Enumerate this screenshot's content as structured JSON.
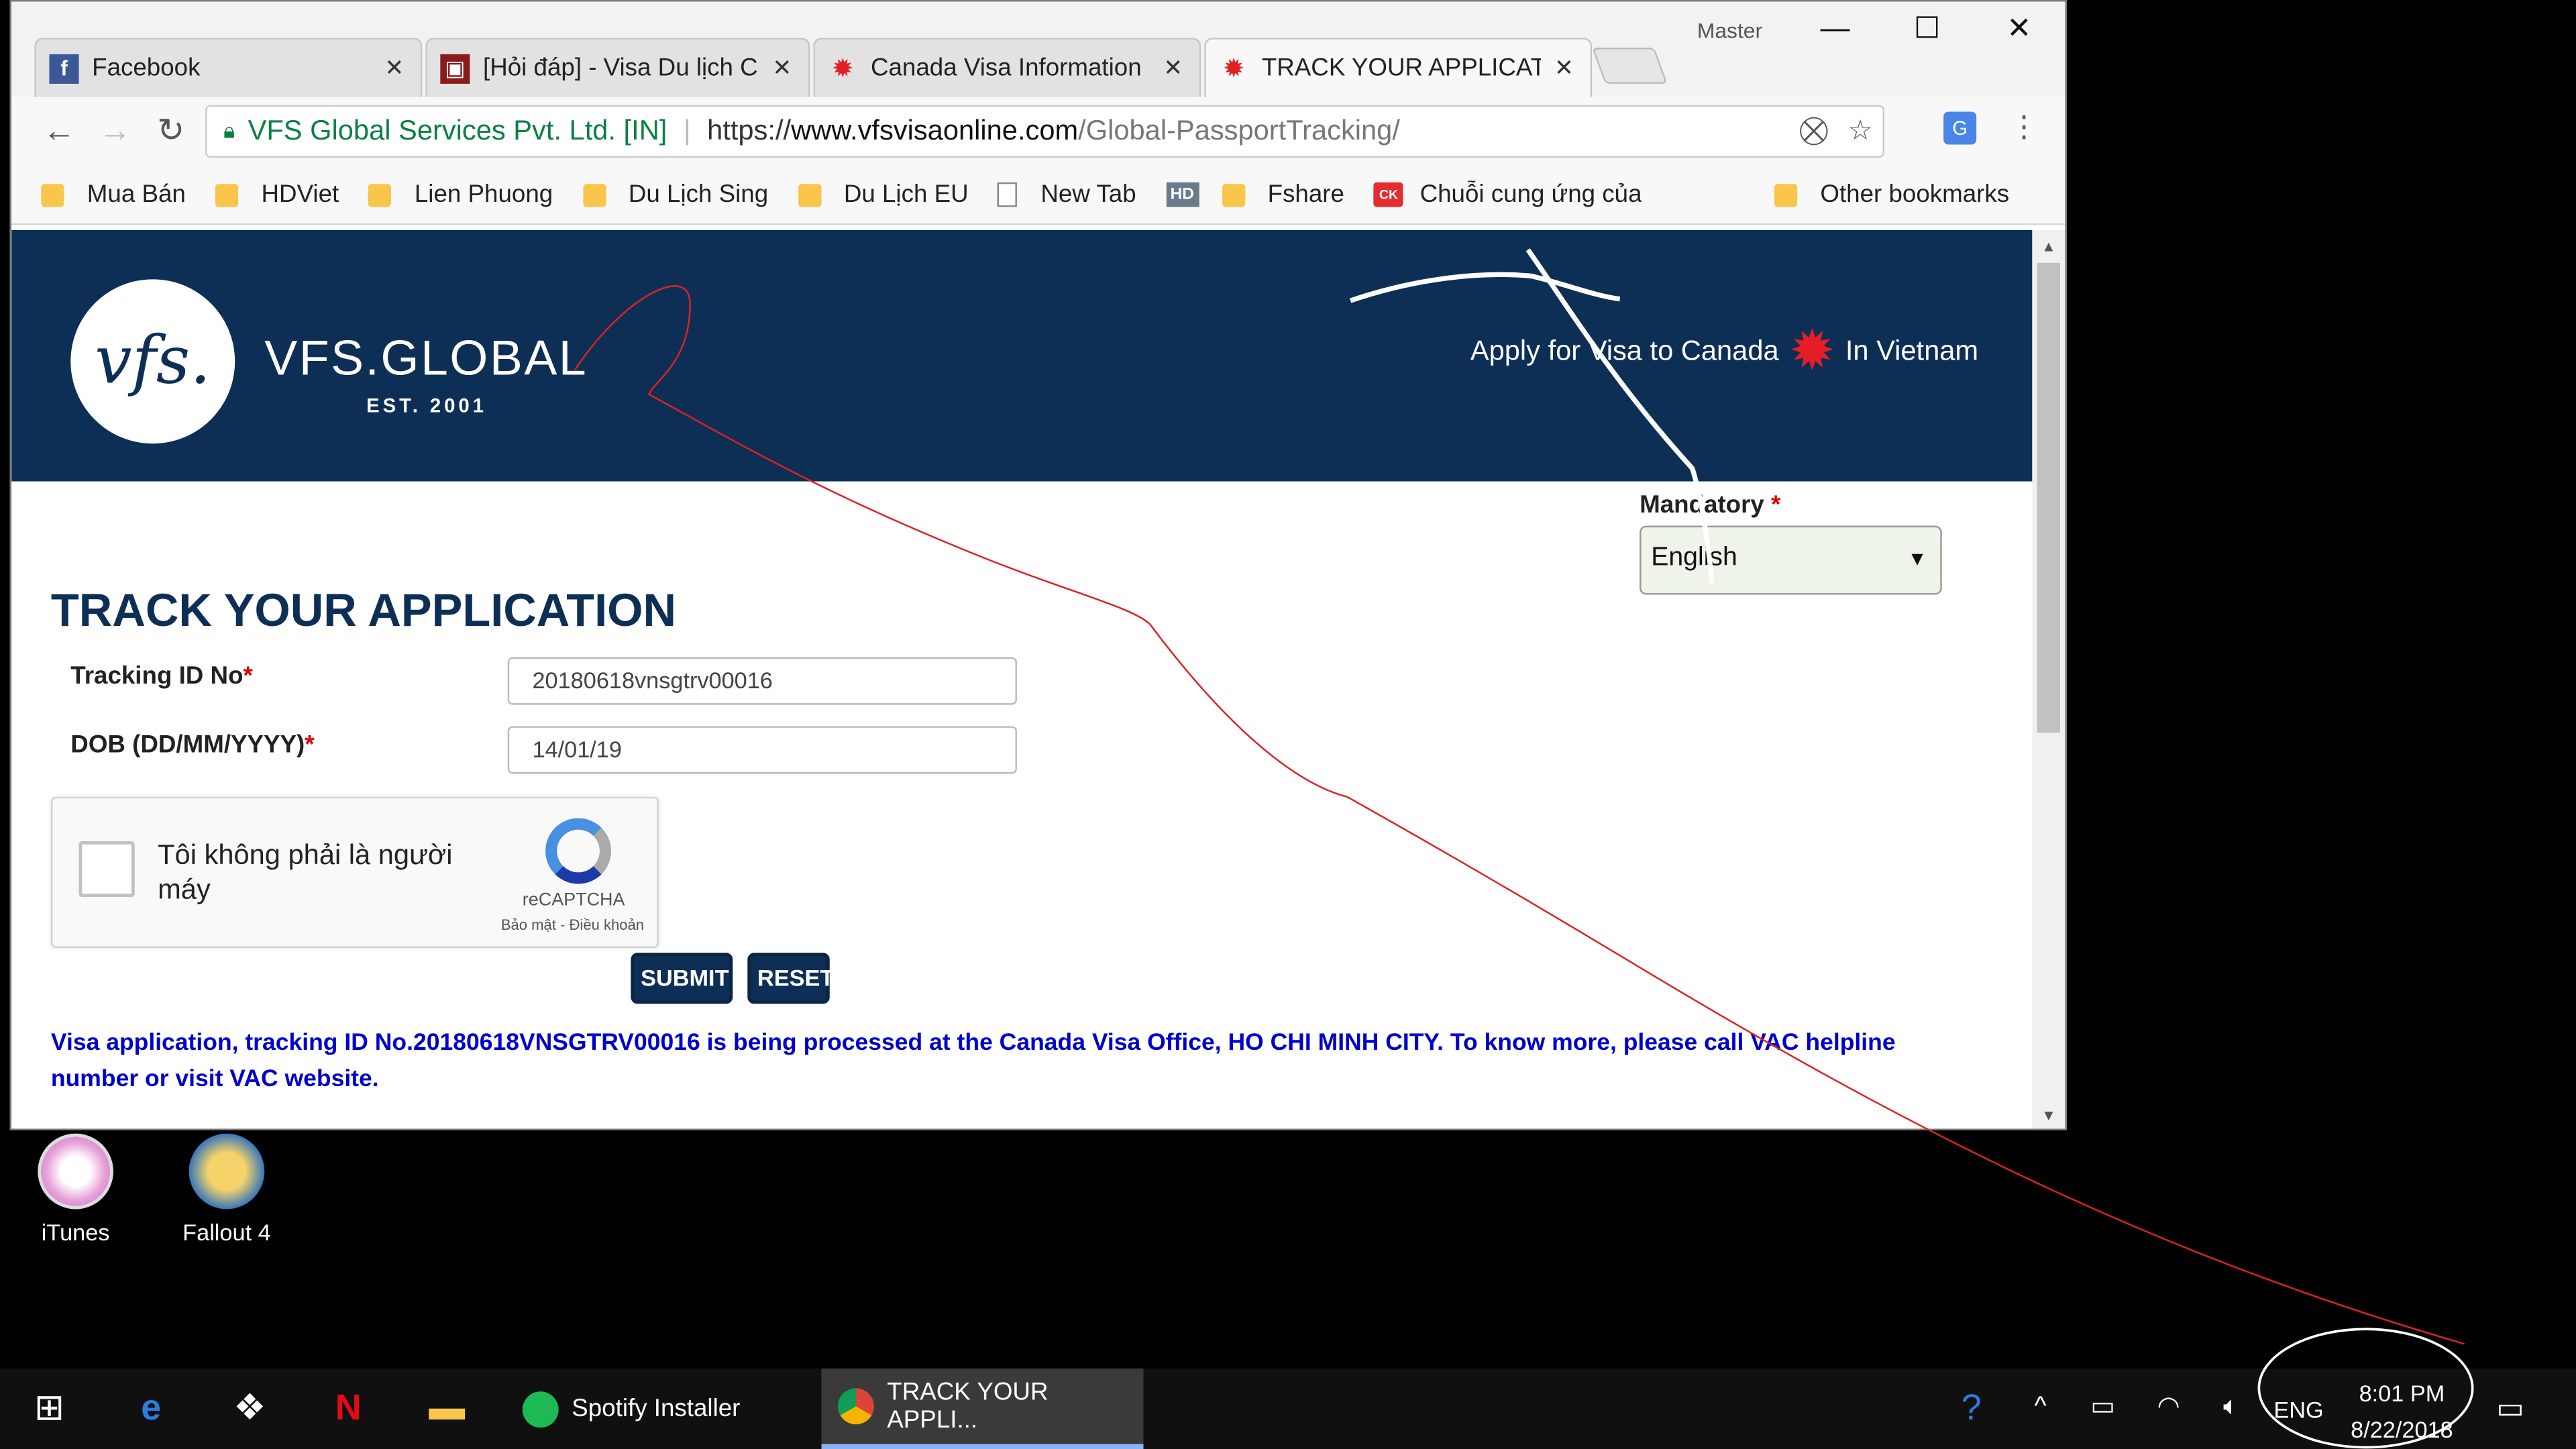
{
  "window": {
    "profile": "Master",
    "tabs": [
      {
        "title": "Facebook",
        "icon": "facebook-icon"
      },
      {
        "title": "[Hỏi đáp] - Visa Du lịch C",
        "icon": "forum-icon"
      },
      {
        "title": "Canada Visa Information",
        "icon": "maple-leaf-icon"
      },
      {
        "title": "TRACK YOUR APPLICATIC",
        "icon": "maple-leaf-icon"
      }
    ],
    "controls": {
      "minimize": "—",
      "maximize": "☐",
      "close": "✕"
    }
  },
  "toolbar": {
    "back": "←",
    "forward": "→",
    "reload": "↻",
    "site_org": "VFS Global Services Pvt. Ltd. [IN]",
    "url_scheme": "https://",
    "url_host": "www.vfsvisaonline.com",
    "url_path": "/Global-PassportTracking/",
    "menu": "⋮"
  },
  "bookmarks": [
    {
      "label": "Mua Bán",
      "icon": "folder-icon"
    },
    {
      "label": "HDViet",
      "icon": "folder-icon"
    },
    {
      "label": "Lien Phuong",
      "icon": "folder-icon"
    },
    {
      "label": "Du Lịch Sing",
      "icon": "folder-icon"
    },
    {
      "label": "Du Lịch EU",
      "icon": "folder-icon"
    },
    {
      "label": "New Tab",
      "icon": "page-icon"
    },
    {
      "label": "Fshare",
      "icon": "folder-icon"
    },
    {
      "label": "Chuỗi cung ứng của",
      "icon": "ck-icon"
    }
  ],
  "bookmarks_other": "Other bookmarks",
  "header": {
    "logo_mark": "vfs.",
    "logo_text": "VFS.GLOBAL",
    "logo_est": "EST. 2001",
    "apply_prefix": "Apply for Visa to Canada",
    "apply_suffix": "In Vietnam"
  },
  "language": {
    "label": "Mandatory",
    "required_mark": "*",
    "selected": "English"
  },
  "form": {
    "title": "TRACK YOUR APPLICATION",
    "tracking_label": "Tracking ID No",
    "tracking_value": "20180618vnsgtrv00016",
    "dob_label": "DOB (DD/MM/YYYY)",
    "dob_value": "14/01/19",
    "required_mark": "*",
    "captcha_text": "Tôi không phải là người máy",
    "captcha_brand": "reCAPTCHA",
    "captcha_terms": "Bảo mật - Điều khoản",
    "submit": "SUBMIT",
    "reset": "RESET"
  },
  "status_message": "Visa application, tracking ID No.20180618VNSGTRV00016 is being processed at the Canada Visa Office, HO CHI MINH CITY. To know more, please call VAC helpline number or visit VAC website.",
  "desktop_icons": [
    {
      "label": "iTunes",
      "icon": "itunes-icon"
    },
    {
      "label": "Fallout 4",
      "icon": "fallout-icon"
    }
  ],
  "taskbar": {
    "apps": [
      {
        "label": "Spotify Installer",
        "icon": "spotify-icon"
      },
      {
        "label": "TRACK YOUR APPLI...",
        "icon": "chrome-icon"
      }
    ],
    "language": "ENG",
    "time": "8:01 PM",
    "date": "8/22/2018"
  },
  "colors": {
    "brand_navy": "#0d2f56",
    "maple_red": "#e41e26",
    "status_blue": "#0000cc",
    "secure_green": "#0b8043"
  }
}
